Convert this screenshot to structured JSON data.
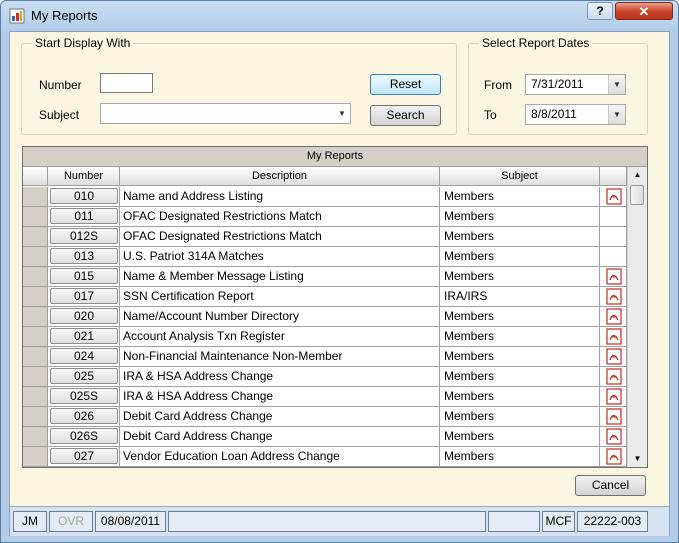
{
  "window": {
    "title": "My Reports",
    "help_label": "?",
    "close_label": "✕"
  },
  "start_display": {
    "group_label": "Start Display With",
    "number_label": "Number",
    "number_value": "",
    "subject_label": "Subject",
    "subject_value": "",
    "reset_label": "Reset",
    "search_label": "Search"
  },
  "report_dates": {
    "group_label": "Select Report Dates",
    "from_label": "From",
    "from_value": "7/31/2011",
    "to_label": "To",
    "to_value": "8/8/2011"
  },
  "grid": {
    "caption": "My Reports",
    "columns": [
      "Number",
      "Description",
      "Subject"
    ],
    "rows": [
      {
        "number": "010",
        "description": "Name and Address Listing",
        "subject": "Members",
        "pdf": true
      },
      {
        "number": "011",
        "description": "OFAC Designated Restrictions Match",
        "subject": "Members",
        "pdf": false
      },
      {
        "number": "012S",
        "description": "OFAC Designated Restrictions Match",
        "subject": "Members",
        "pdf": false
      },
      {
        "number": "013",
        "description": "U.S. Patriot 314A Matches",
        "subject": "Members",
        "pdf": false
      },
      {
        "number": "015",
        "description": "Name & Member Message Listing",
        "subject": "Members",
        "pdf": true
      },
      {
        "number": "017",
        "description": "SSN Certification Report",
        "subject": "IRA/IRS",
        "pdf": true
      },
      {
        "number": "020",
        "description": "Name/Account Number Directory",
        "subject": "Members",
        "pdf": true
      },
      {
        "number": "021",
        "description": "Account Analysis Txn Register",
        "subject": "Members",
        "pdf": true
      },
      {
        "number": "024",
        "description": "Non-Financial Maintenance Non-Member",
        "subject": "Members",
        "pdf": true
      },
      {
        "number": "025",
        "description": "IRA & HSA Address Change",
        "subject": "Members",
        "pdf": true
      },
      {
        "number": "025S",
        "description": "IRA & HSA Address Change",
        "subject": "Members",
        "pdf": true
      },
      {
        "number": "026",
        "description": "Debit Card Address Change",
        "subject": "Members",
        "pdf": true
      },
      {
        "number": "026S",
        "description": "Debit Card Address Change",
        "subject": "Members",
        "pdf": true
      },
      {
        "number": "027",
        "description": "Vendor Education Loan Address Change",
        "subject": "Members",
        "pdf": true
      }
    ]
  },
  "cancel_label": "Cancel",
  "status": {
    "user": "JM",
    "ovr": "OVR",
    "date": "08/08/2011",
    "blank1": "",
    "blank2": "",
    "mode": "MCF",
    "code": "22222-003"
  },
  "colors": {
    "pdf_red": "#c8281e",
    "form_bg": "#fbf6e2",
    "frame": "#b3cde9"
  },
  "icons": {
    "app": "reports-app-icon",
    "pdf": "pdf-icon",
    "dropdown": "chevron-down-icon"
  }
}
